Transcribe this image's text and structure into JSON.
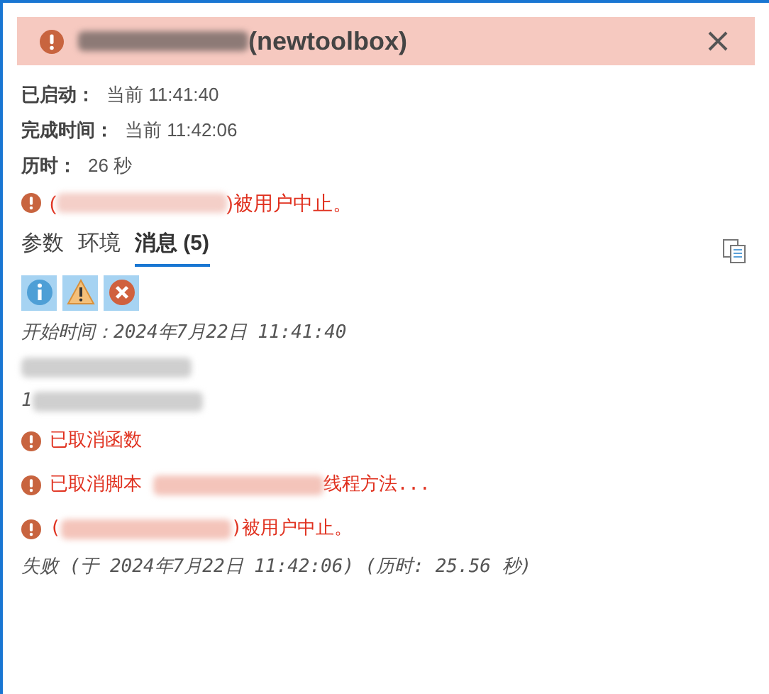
{
  "header": {
    "kind": "error",
    "segments": [
      {
        "kind": "redacted"
      },
      {
        "kind": "text",
        "text": "(newtoolbox)"
      }
    ]
  },
  "details": [
    {
      "label": "已启动：",
      "value": "当前 11:41:40"
    },
    {
      "label": "完成时间：",
      "value": "当前 11:42:06"
    },
    {
      "label": "历时：",
      "value": "26 秒"
    }
  ],
  "summary": {
    "kind": "error",
    "segments": [
      {
        "kind": "text",
        "text": "("
      },
      {
        "kind": "redacted"
      },
      {
        "kind": "text",
        "text": ")被用户中止。"
      }
    ]
  },
  "tabs": [
    {
      "label": "参数",
      "selected": false
    },
    {
      "label": "环境",
      "selected": false
    },
    {
      "label": "消息 (5)",
      "selected": true
    }
  ],
  "filters": [
    {
      "kind": "info",
      "on": true
    },
    {
      "kind": "warning",
      "on": true
    },
    {
      "kind": "error",
      "on": true
    }
  ],
  "messages": [
    {
      "kind": "info",
      "segments": [
        {
          "kind": "text",
          "text": "开始时间：2024年7月22日 11:41:40"
        }
      ]
    },
    {
      "kind": "info",
      "segments": [
        {
          "kind": "redacted"
        }
      ]
    },
    {
      "kind": "info",
      "segments": [
        {
          "kind": "text",
          "text": "1"
        },
        {
          "kind": "redacted"
        }
      ]
    },
    {
      "kind": "error",
      "segments": [
        {
          "kind": "text",
          "text": "已取消函数"
        }
      ]
    },
    {
      "kind": "error",
      "segments": [
        {
          "kind": "text",
          "text": "已取消脚本 "
        },
        {
          "kind": "redacted"
        },
        {
          "kind": "text",
          "text": "线程方法..."
        }
      ]
    },
    {
      "kind": "error",
      "segments": [
        {
          "kind": "text",
          "text": "("
        },
        {
          "kind": "redacted"
        },
        {
          "kind": "text",
          "text": ")被用户中止。"
        }
      ]
    },
    {
      "kind": "info",
      "segments": [
        {
          "kind": "text",
          "text": "失败 (于 2024年7月22日 11:42:06) (历时: 25.56 秒)"
        }
      ]
    }
  ]
}
